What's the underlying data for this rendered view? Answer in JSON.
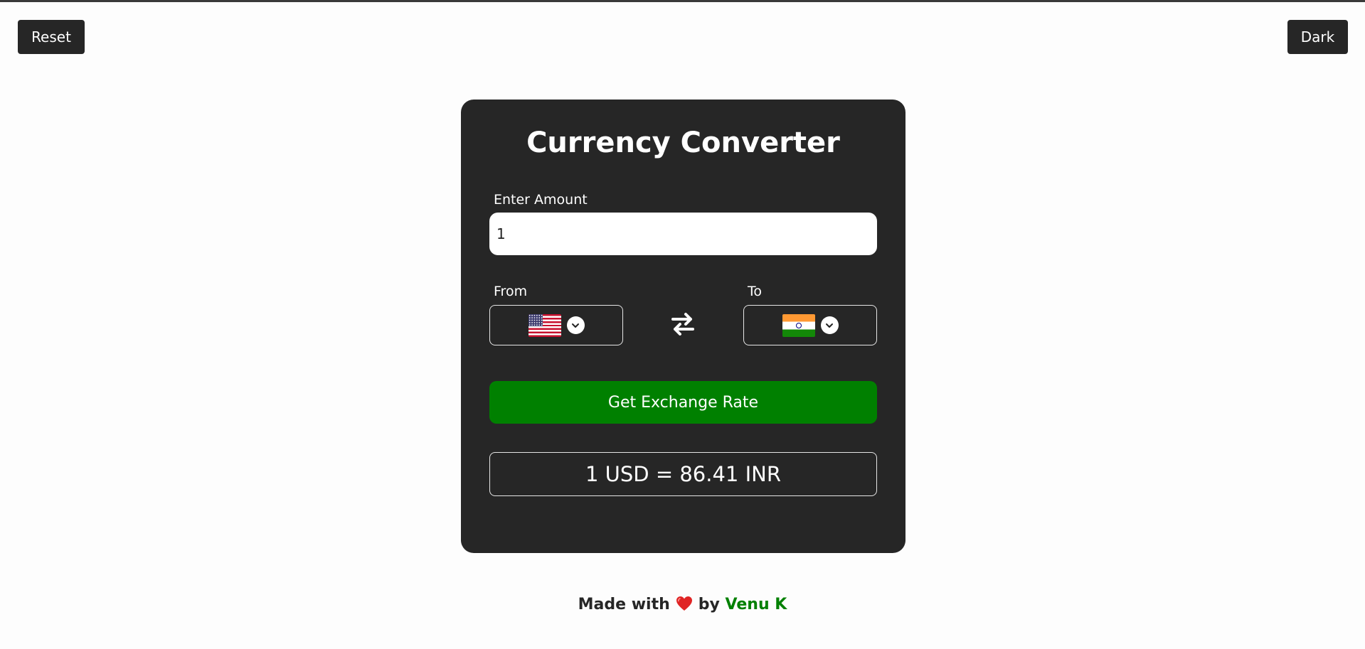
{
  "top_bar": {
    "reset_label": "Reset",
    "theme_label": "Dark"
  },
  "converter": {
    "title": "Currency Converter",
    "amount_label": "Enter Amount",
    "amount_value": "1",
    "from_label": "From",
    "to_label": "To",
    "from_currency": "USD",
    "to_currency": "INR",
    "from_flag_icon": "us-flag-icon",
    "to_flag_icon": "india-flag-icon",
    "swap_icon": "swap-arrows-icon",
    "button_label": "Get Exchange Rate",
    "result": "1 USD = 86.41 INR"
  },
  "footer": {
    "made_with": "Made with",
    "heart_icon": "heart-icon",
    "by": "by",
    "author": "Venu K"
  },
  "colors": {
    "background": "#fdfdfd",
    "card": "#262626",
    "accent_green": "#008000",
    "button_dark": "#262626"
  }
}
